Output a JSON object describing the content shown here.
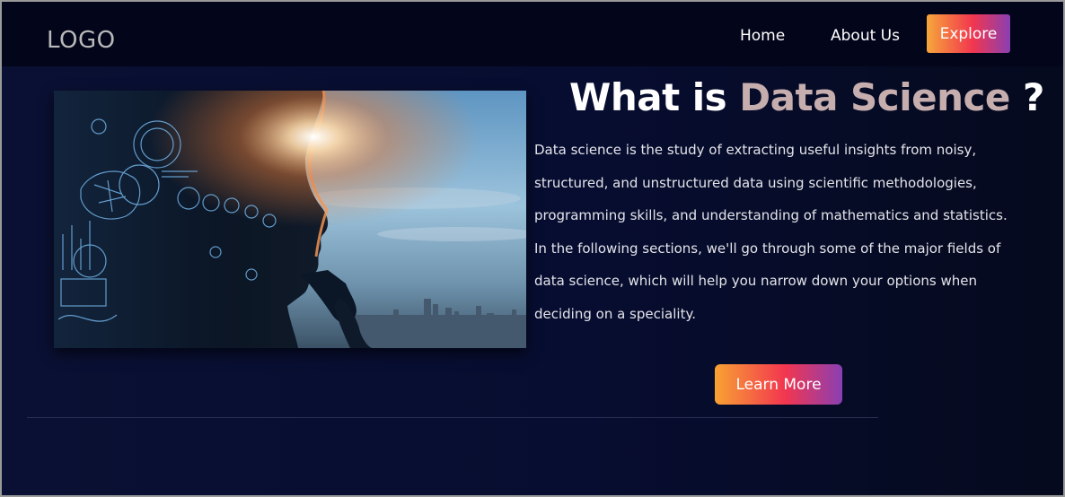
{
  "navbar": {
    "logo": "LOGO",
    "links": [
      {
        "label": "Home"
      },
      {
        "label": "About Us"
      }
    ],
    "explore_label": "Explore"
  },
  "hero": {
    "title_prefix": "What is",
    "title_accent": "Data Science",
    "title_suffix": "?",
    "description": "Data science is the study of extracting useful insights from noisy, structured, and unstructured data using scientific methodologies, programming skills, and understanding of mathematics and statistics. In the following sections, we'll go through some of the major fields of data science, which will help you narrow down your options when deciding on a speciality.",
    "learn_more_label": "Learn More"
  },
  "colors": {
    "background": "#070d30",
    "navbar": "#03051a",
    "accent_text": "#c6aeae",
    "button_gradient": [
      "#f8a233",
      "#f2364f",
      "#8a3fb3"
    ]
  }
}
